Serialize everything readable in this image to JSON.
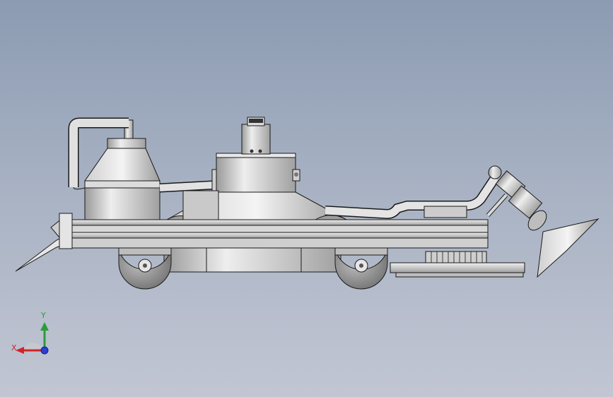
{
  "viewport": {
    "background_top": "#8c9bb2",
    "background_bottom": "#c2c6d3"
  },
  "model": {
    "part_color": "#d9d9d9",
    "edge_color": "#1a1a1a",
    "shade_color": "#a8a8a8"
  },
  "triad": {
    "x_label": "X",
    "y_label": "Y",
    "x_color": "#d2232a",
    "y_color": "#2a9d3a",
    "z_color": "#2b3fd6"
  }
}
